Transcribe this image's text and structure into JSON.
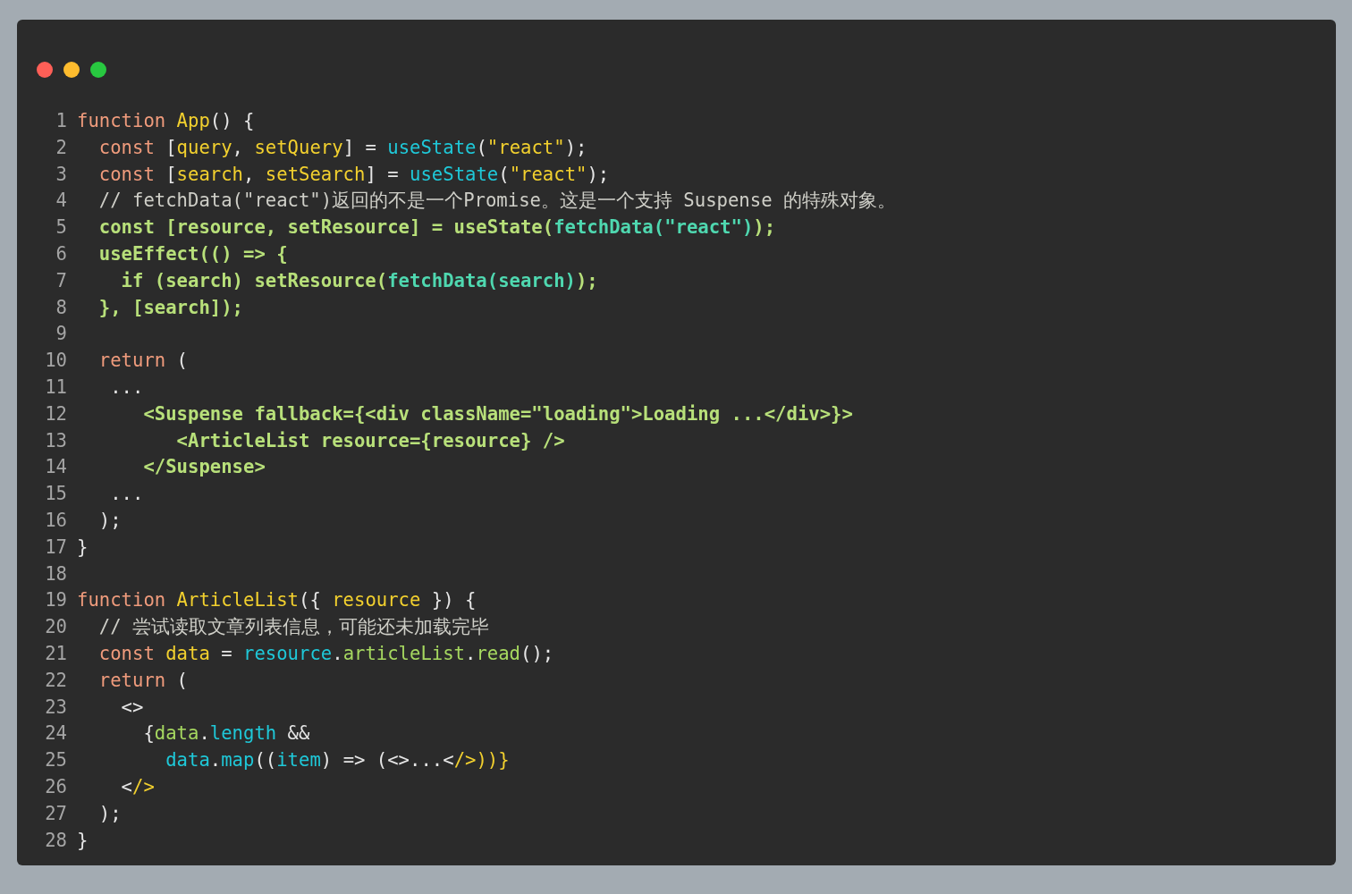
{
  "window": {
    "controls": [
      {
        "kind": "close"
      },
      {
        "kind": "minimize"
      },
      {
        "kind": "zoom"
      }
    ]
  },
  "code": [
    {
      "number": "1",
      "tokens": [
        {
          "kind": "kw",
          "text": "function "
        },
        {
          "kind": "id",
          "text": "App"
        },
        {
          "kind": "p",
          "text": "() {"
        }
      ]
    },
    {
      "number": "2",
      "tokens": [
        {
          "kind": "kw",
          "text": "  const "
        },
        {
          "kind": "p",
          "text": "["
        },
        {
          "kind": "id",
          "text": "query"
        },
        {
          "kind": "p",
          "text": ", "
        },
        {
          "kind": "id",
          "text": "setQuery"
        },
        {
          "kind": "p",
          "text": "] = "
        },
        {
          "kind": "fn",
          "text": "useState"
        },
        {
          "kind": "p",
          "text": "("
        },
        {
          "kind": "id",
          "text": "\"react\""
        },
        {
          "kind": "p",
          "text": ");"
        }
      ]
    },
    {
      "number": "3",
      "tokens": [
        {
          "kind": "kw",
          "text": "  const "
        },
        {
          "kind": "p",
          "text": "["
        },
        {
          "kind": "id",
          "text": "search"
        },
        {
          "kind": "p",
          "text": ", "
        },
        {
          "kind": "id",
          "text": "setSearch"
        },
        {
          "kind": "p",
          "text": "] = "
        },
        {
          "kind": "fn",
          "text": "useState"
        },
        {
          "kind": "p",
          "text": "("
        },
        {
          "kind": "id",
          "text": "\"react\""
        },
        {
          "kind": "p",
          "text": ");"
        }
      ]
    },
    {
      "number": "4",
      "tokens": [
        {
          "kind": "comment",
          "text": "  // fetchData(\"react\")返回的不是一个Promise。这是一个支持 Suspense 的特殊对象。"
        }
      ]
    },
    {
      "number": "5",
      "tokens": [
        {
          "kind": "hl",
          "text": "  const [resource, setResource] = useState("
        },
        {
          "kind": "hlfn",
          "text": "fetchData(\"react\")"
        },
        {
          "kind": "hl",
          "text": ");"
        }
      ]
    },
    {
      "number": "6",
      "tokens": [
        {
          "kind": "hl",
          "text": "  useEffect(() => {"
        }
      ]
    },
    {
      "number": "7",
      "tokens": [
        {
          "kind": "hl",
          "text": "    if (search) setResource("
        },
        {
          "kind": "hlfn",
          "text": "fetchData(search)"
        },
        {
          "kind": "hl",
          "text": ");"
        }
      ]
    },
    {
      "number": "8",
      "tokens": [
        {
          "kind": "hl",
          "text": "  }, [search]);"
        }
      ]
    },
    {
      "number": "9"
    },
    {
      "number": "10",
      "tokens": [
        {
          "kind": "kw",
          "text": "  return "
        },
        {
          "kind": "p",
          "text": "("
        }
      ]
    },
    {
      "number": "11",
      "tokens": [
        {
          "kind": "p",
          "text": "   ..."
        }
      ]
    },
    {
      "number": "12",
      "tokens": [
        {
          "kind": "hl",
          "text": "      <Suspense fallback={<div className=\"loading\">Loading ...</div>}>"
        }
      ]
    },
    {
      "number": "13",
      "tokens": [
        {
          "kind": "hl",
          "text": "         <ArticleList resource={resource} />"
        }
      ]
    },
    {
      "number": "14",
      "tokens": [
        {
          "kind": "hl",
          "text": "      </Suspense>"
        }
      ]
    },
    {
      "number": "15",
      "tokens": [
        {
          "kind": "p",
          "text": "   ..."
        }
      ]
    },
    {
      "number": "16",
      "tokens": [
        {
          "kind": "p",
          "text": "  );"
        }
      ]
    },
    {
      "number": "17",
      "tokens": [
        {
          "kind": "p",
          "text": "}"
        }
      ]
    },
    {
      "number": "18"
    },
    {
      "number": "19",
      "tokens": [
        {
          "kind": "kw",
          "text": "function "
        },
        {
          "kind": "id",
          "text": "ArticleList"
        },
        {
          "kind": "p",
          "text": "({ "
        },
        {
          "kind": "id",
          "text": "resource"
        },
        {
          "kind": "p",
          "text": " }) {"
        }
      ]
    },
    {
      "number": "20",
      "tokens": [
        {
          "kind": "comment",
          "text": "  // 尝试读取文章列表信息，可能还未加载完毕"
        }
      ]
    },
    {
      "number": "21",
      "tokens": [
        {
          "kind": "kw",
          "text": "  const "
        },
        {
          "kind": "id",
          "text": "data"
        },
        {
          "kind": "p",
          "text": " = "
        },
        {
          "kind": "fn",
          "text": "resource"
        },
        {
          "kind": "p",
          "text": "."
        },
        {
          "kind": "prop",
          "text": "articleList"
        },
        {
          "kind": "p",
          "text": "."
        },
        {
          "kind": "prop",
          "text": "read"
        },
        {
          "kind": "p",
          "text": "();"
        }
      ]
    },
    {
      "number": "22",
      "tokens": [
        {
          "kind": "kw",
          "text": "  return "
        },
        {
          "kind": "p",
          "text": "("
        }
      ]
    },
    {
      "number": "23",
      "tokens": [
        {
          "kind": "p",
          "text": "    <>"
        }
      ]
    },
    {
      "number": "24",
      "tokens": [
        {
          "kind": "p",
          "text": "      {"
        },
        {
          "kind": "prop",
          "text": "data"
        },
        {
          "kind": "p",
          "text": "."
        },
        {
          "kind": "fn",
          "text": "length"
        },
        {
          "kind": "p",
          "text": " &&"
        }
      ]
    },
    {
      "number": "25",
      "tokens": [
        {
          "kind": "fn",
          "text": "        data"
        },
        {
          "kind": "p",
          "text": "."
        },
        {
          "kind": "fn",
          "text": "map"
        },
        {
          "kind": "p",
          "text": "(("
        },
        {
          "kind": "fn",
          "text": "item"
        },
        {
          "kind": "p",
          "text": ") => (<>...<"
        },
        {
          "kind": "id",
          "text": "/>))}"
        }
      ]
    },
    {
      "number": "26",
      "tokens": [
        {
          "kind": "p",
          "text": "    <"
        },
        {
          "kind": "id",
          "text": "/>"
        }
      ]
    },
    {
      "number": "27",
      "tokens": [
        {
          "kind": "p",
          "text": "  );"
        }
      ]
    },
    {
      "number": "28",
      "tokens": [
        {
          "kind": "p",
          "text": "}"
        }
      ]
    }
  ]
}
